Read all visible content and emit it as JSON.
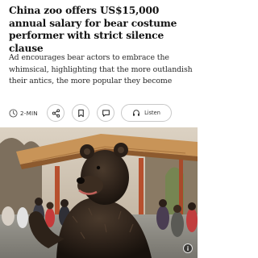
{
  "article": {
    "headline": "China zoo offers US$15,000 annual salary for bear costume performer with strict silence clause",
    "standfirst": "Ad encourages bear actors to embrace the whimsical, highlighting that the more outlandish their antics, the more popular they become"
  },
  "toolbar": {
    "read_time": "2-MIN",
    "listen_label": "Listen"
  },
  "icons": {
    "clock": "clock-icon",
    "share": "share-icon",
    "bookmark": "bookmark-icon",
    "comment": "comment-icon",
    "headphones": "headphones-icon",
    "info": "info-icon"
  },
  "colors": {
    "text": "#121212",
    "border": "#c9c9c9"
  }
}
